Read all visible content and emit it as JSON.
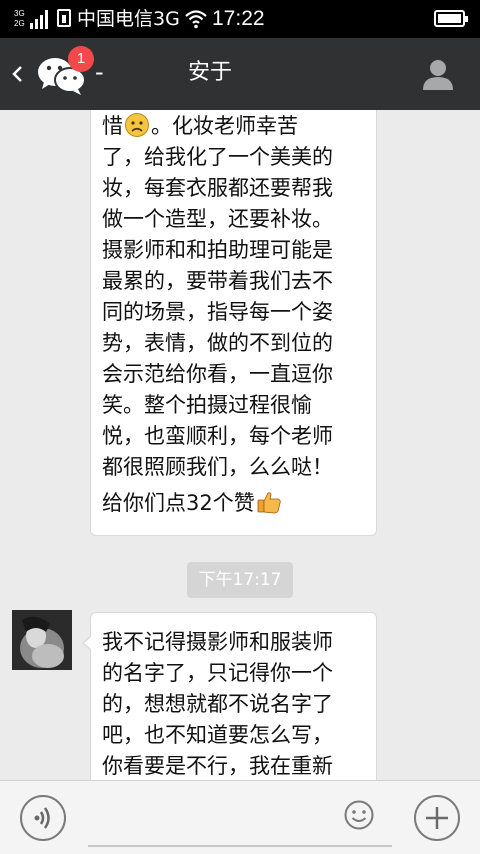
{
  "status_bar": {
    "network_3g": "3G",
    "network_2g": "2G",
    "carrier": "中国电信3G",
    "time": "17:22"
  },
  "header": {
    "back_icon": "chevron-left-icon",
    "app_icon": "wechat-icon",
    "unread_badge": "1",
    "separator": "-",
    "title": "安于",
    "profile_icon": "person-icon"
  },
  "messages": [
    {
      "sender": "other",
      "lines": [
        "惜",
        "。化妆老师幸苦",
        "了，给我化了一个美美的",
        "妆，每套衣服都还要帮我",
        "做一个造型，还要补妆。",
        "摄影师和和拍助理可能是",
        "最累的，要带着我们去不",
        "同的场景，指导每一个姿",
        "势，表情，做的不到位的",
        "会示范给你看，一直逗你",
        "笑。整个拍摄过程很愉",
        "悦，也蛮顺利，每个老师",
        "都很照顾我们，么么哒！",
        "给你们点32个赞"
      ],
      "emoji": [
        "sad-face-icon",
        "thumbs-up-icon"
      ]
    },
    {
      "timestamp": "下午17:17"
    },
    {
      "sender": "other",
      "avatar": "avatar-photo",
      "lines": [
        "我不记得摄影师和服装师",
        "的名字了，只记得你一个",
        "的，想想就都不说名字了",
        "吧，也不知道要怎么写，",
        "你看要是不行，我在重新"
      ]
    }
  ],
  "input_bar": {
    "voice_icon": "voice-icon",
    "input_value": "",
    "emoji_icon": "smiley-icon",
    "plus_icon": "plus-icon"
  },
  "colors": {
    "status_bar": "#000000",
    "header": "#2f3133",
    "chat_background": "#ebebeb",
    "badge": "#f24a4a",
    "bubble": "#ffffff",
    "timestamp_bg": "#d5d5d5"
  }
}
